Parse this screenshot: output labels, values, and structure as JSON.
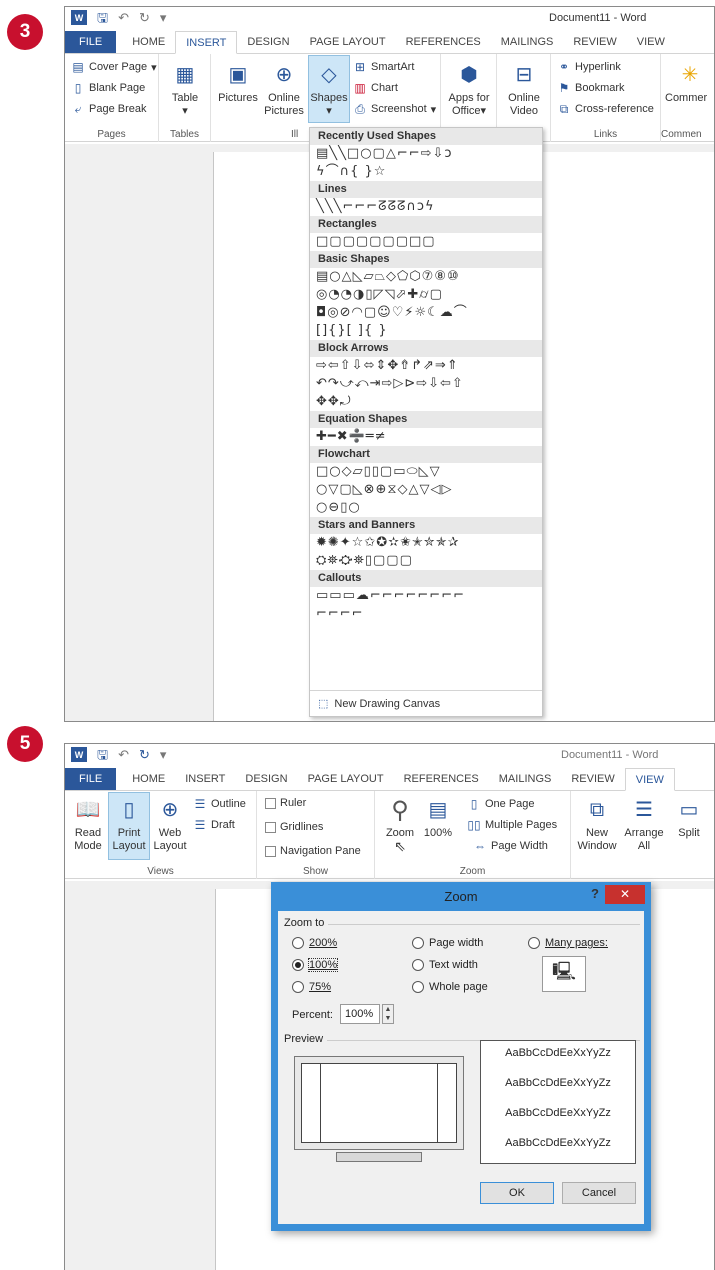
{
  "steps": {
    "s1": "3",
    "s2": "5"
  },
  "panel1": {
    "window_title": "Document11 - Word",
    "tabs": [
      "FILE",
      "HOME",
      "INSERT",
      "DESIGN",
      "PAGE LAYOUT",
      "REFERENCES",
      "MAILINGS",
      "REVIEW",
      "VIEW"
    ],
    "pages": {
      "cover": "Cover Page",
      "blank": "Blank Page",
      "break": "Page Break",
      "label": "Pages"
    },
    "tables": {
      "table": "Table",
      "label": "Tables"
    },
    "illustrations": {
      "pictures": "Pictures",
      "online1": "Online",
      "online2": "Pictures",
      "shapes": "Shapes",
      "smartart": "SmartArt",
      "chart": "Chart",
      "screenshot": "Screenshot",
      "label": "Ill"
    },
    "apps": {
      "apps1": "Apps for",
      "apps2": "Office"
    },
    "media": {
      "video1": "Online",
      "video2": "Video"
    },
    "links": {
      "hyperlink": "Hyperlink",
      "bookmark": "Bookmark",
      "crossref": "Cross-reference",
      "label": "Links"
    },
    "comments": {
      "comment": "Commer",
      "label": "Commen"
    },
    "gallery": {
      "sections": [
        {
          "title": "Recently Used Shapes",
          "rows": [
            "▤╲╲□○▢△⌐⌐⇨⇩ↄ",
            "ϟ⌒∩{ }☆"
          ]
        },
        {
          "title": "Lines",
          "rows": [
            "╲╲╲⌐⌐⌐ᘔᘔᘔ∩ↄϟ"
          ]
        },
        {
          "title": "Rectangles",
          "rows": [
            "□▢▢▢▢▢▢□▢"
          ]
        },
        {
          "title": "Basic Shapes",
          "rows": [
            "▤○△◺▱⏢◇⬠⬡⑦⑧⑩",
            "◎◔◔◑▯◸◹⬀✚⌭▢",
            "◘◎⊘◠▢☺♡⚡☼☾☁⌒",
            "[]{}[ ]{ }"
          ]
        },
        {
          "title": "Block Arrows",
          "rows": [
            "⇨⇦⇧⇩⬄⇕✥⇮↱⇗⇒⇑",
            "↶↷⤻⤺⇥⇨▷⊳⇨⇩⇦⇧",
            "✥✥⤾"
          ]
        },
        {
          "title": "Equation Shapes",
          "rows": [
            "✚━✖➗═≠"
          ]
        },
        {
          "title": "Flowchart",
          "rows": [
            "□○◇▱▯▯▢▭⬭◺▽",
            "○▽▢◺⊗⊕⧖◇△▽◁▷",
            "○⊖▯○"
          ]
        },
        {
          "title": "Stars and Banners",
          "rows": [
            "✹✺✦☆✩✪✫✬✭✮✯✰",
            "⛭⛯⛮⛯▯▢▢▢"
          ]
        },
        {
          "title": "Callouts",
          "rows": [
            "▭▭▭☁⌐⌐⌐⌐⌐⌐⌐⌐",
            "⌐⌐⌐⌐"
          ]
        }
      ],
      "new_canvas": "New Drawing Canvas"
    }
  },
  "panel2": {
    "window_title": "Document11 - Word",
    "tabs": [
      "FILE",
      "HOME",
      "INSERT",
      "DESIGN",
      "PAGE LAYOUT",
      "REFERENCES",
      "MAILINGS",
      "REVIEW",
      "VIEW"
    ],
    "views": {
      "read1": "Read",
      "read2": "Mode",
      "print1": "Print",
      "print2": "Layout",
      "web1": "Web",
      "web2": "Layout",
      "outline": "Outline",
      "draft": "Draft",
      "label": "Views"
    },
    "show": {
      "ruler": "Ruler",
      "gridlines": "Gridlines",
      "navpane": "Navigation Pane",
      "label": "Show"
    },
    "zoomgrp": {
      "zoom": "Zoom",
      "pct": "100%",
      "onepage": "One Page",
      "multi": "Multiple Pages",
      "width": "Page Width",
      "label": "Zoom"
    },
    "window": {
      "new1": "New",
      "new2": "Window",
      "arr1": "Arrange",
      "arr2": "All",
      "split": "Split"
    },
    "dialog": {
      "title": "Zoom",
      "help": "?",
      "close": "✕",
      "zoom_to": "Zoom to",
      "r200": "200%",
      "r100": "100%",
      "r75": "75%",
      "pagewidth": "Page width",
      "textwidth": "Text width",
      "wholepage": "Whole page",
      "manypages": "Many pages:",
      "percent_label": "Percent:",
      "percent_value": "100%",
      "preview": "Preview",
      "samples": [
        "AaBbCcDdEeXxYyZz",
        "AaBbCcDdEeXxYyZz",
        "AaBbCcDdEeXxYyZz",
        "AaBbCcDdEeXxYyZz"
      ],
      "ok": "OK",
      "cancel": "Cancel"
    }
  }
}
